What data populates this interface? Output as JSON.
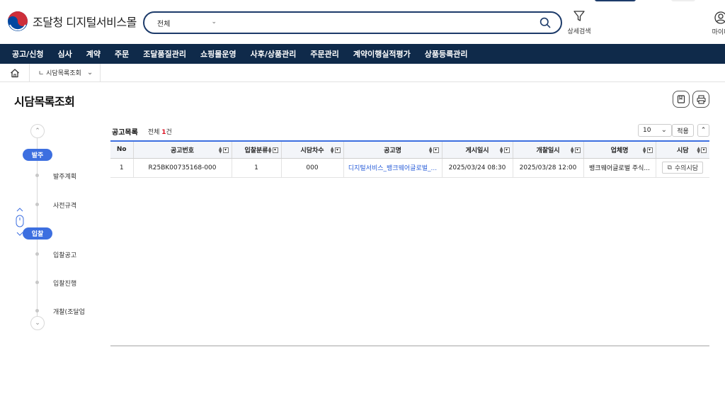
{
  "brand": {
    "name": "조달청 디지털서비스몰",
    "colors": {
      "navy": "#0f2a4a",
      "accent": "#3d6fe0",
      "link": "#2b5fd9",
      "red": "#cd2e3a",
      "blue": "#0047a0"
    }
  },
  "search": {
    "category": "전체",
    "placeholder": "",
    "icon": "search-icon"
  },
  "header": {
    "advanced_search": "상세검색",
    "mypage": "마이페"
  },
  "nav": {
    "items": [
      "공고/신청",
      "심사",
      "계약",
      "주문",
      "조달품질관리",
      "쇼핑몰운영",
      "사후/상품관리",
      "주문관리",
      "계약이행실적평가",
      "상품등록관리"
    ]
  },
  "breadcrumb": {
    "current": "ㄴ 시담목록조회"
  },
  "page": {
    "title": "시담목록조회"
  },
  "steps": {
    "groups": [
      {
        "badge": "발주",
        "items": [
          "발주계획",
          "사전규격"
        ]
      },
      {
        "badge": "입찰",
        "items": [
          "입찰공고",
          "입찰진행",
          "개찰(조달업"
        ]
      }
    ]
  },
  "list": {
    "title": "공고목록",
    "count_prefix": "전체 ",
    "count": "1",
    "count_suffix": "건",
    "page_size": "10",
    "apply_label": "적용",
    "columns": [
      "No",
      "공고번호",
      "입찰분류",
      "시담차수",
      "공고명",
      "게시일시",
      "개찰일시",
      "업체명",
      "시담"
    ],
    "rows": [
      {
        "no": "1",
        "notice_no": "R25BK00735168-000",
        "bid_type": "1",
        "round": "000",
        "notice_name": "디지털서비스_뱅크웨어글로벌_...",
        "posted": "2025/03/24 08:30",
        "opening": "2025/03/28 12:00",
        "company": "뱅크웨어글로벌 주식...",
        "action_label": "수의시담"
      }
    ]
  }
}
